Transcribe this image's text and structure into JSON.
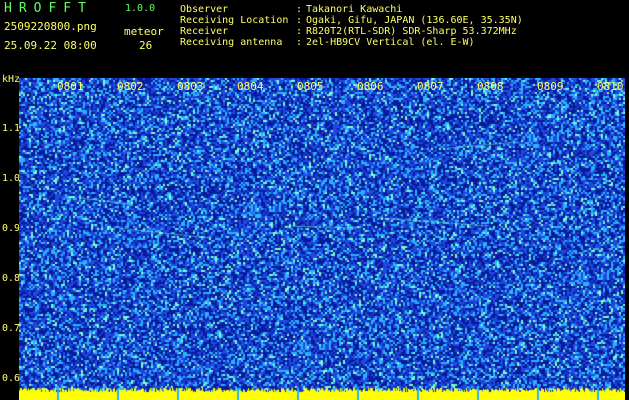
{
  "app": {
    "title": "HROFFT",
    "version": "1.0.0",
    "file_name": "2509220800.png",
    "timestamp": "25.09.22 08:00",
    "meteor_label": "meteor",
    "meteor_count": "26"
  },
  "info": [
    {
      "key": "Observer",
      "value": "Takanori Kawachi"
    },
    {
      "key": "Receiving Location",
      "value": "Ogaki, Gifu, JAPAN (136.60E, 35.35N)"
    },
    {
      "key": "Receiver",
      "value": "R820T2(RTL-SDR) SDR-Sharp 53.372MHz"
    },
    {
      "key": "Receiving antenna",
      "value": "2el-HB9CV Vertical (el. E-W)"
    }
  ],
  "axis": {
    "unit": "kHz",
    "frequency_ticks": [
      "1.1",
      "1.0",
      "0.9",
      "0.8",
      "0.7",
      "0.6"
    ],
    "time_labels": [
      "0801",
      "0802",
      "0803",
      "0804",
      "0805",
      "0806",
      "0807",
      "0808",
      "0809",
      "0810"
    ]
  },
  "colors": {
    "background": "#000000",
    "text": "#ffff66",
    "title": "#5cff5c",
    "noise_dark": "#0a1a9c",
    "noise_mid": "#1f48e0",
    "noise_bright": "#28b4ff",
    "signal": "#7dffd0",
    "baseline": "#ffff00"
  }
}
